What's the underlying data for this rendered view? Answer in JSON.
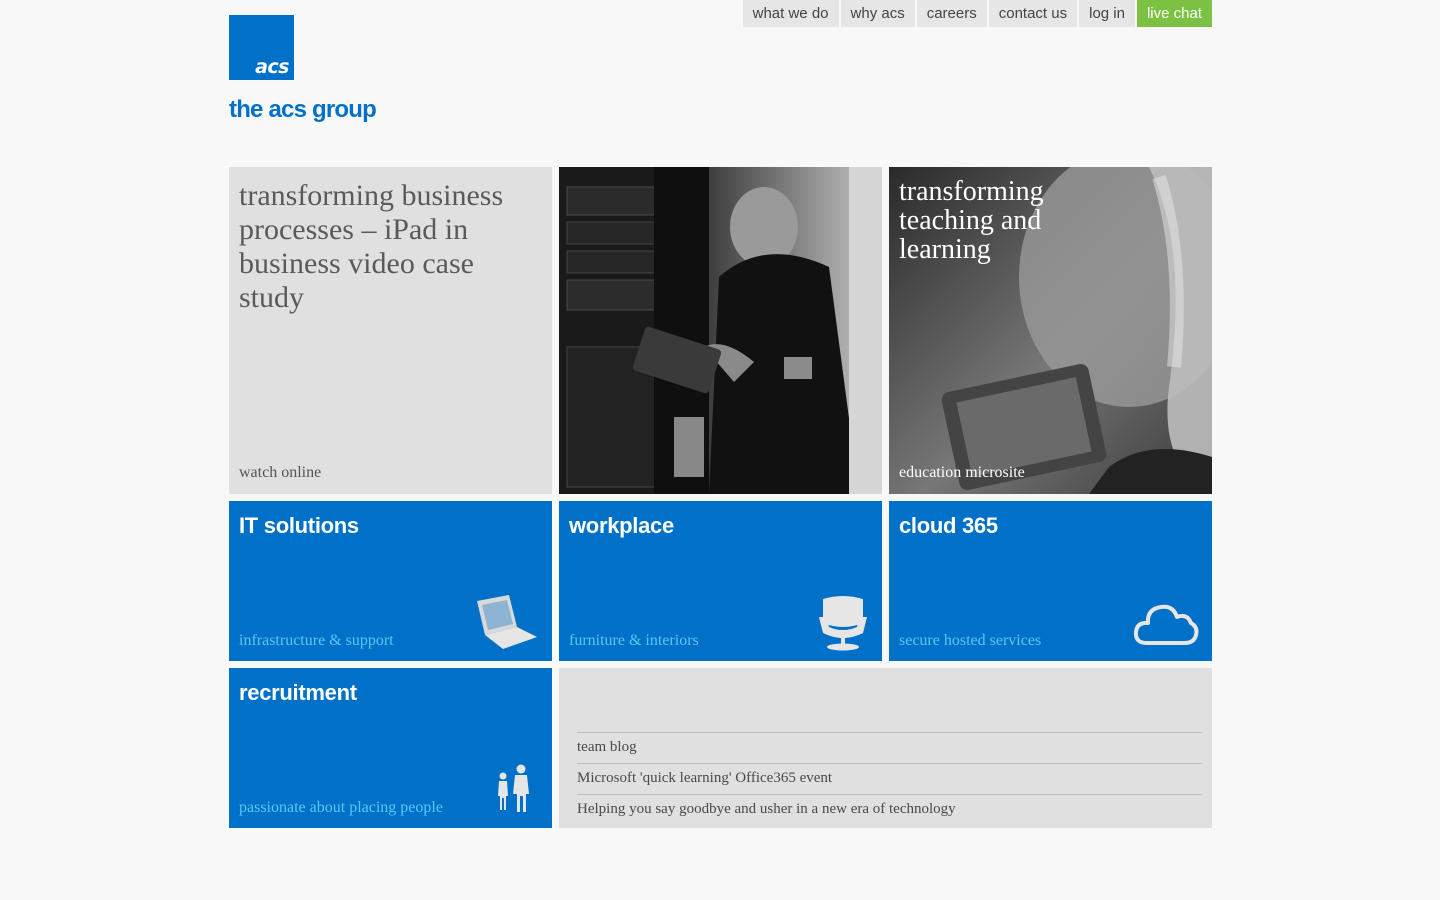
{
  "nav": {
    "items": [
      "what we do",
      "why acs",
      "careers",
      "contact us",
      "log in"
    ],
    "live_chat": "live chat"
  },
  "brand": {
    "logo_text": "acs",
    "site_title": "the acs group",
    "color": "#0070c8"
  },
  "featured": {
    "headline": "transforming business processes – iPad in business video case study",
    "sub": "watch online"
  },
  "education": {
    "headline": "transforming teaching and learning",
    "sub": "education microsite"
  },
  "tiles": {
    "it": {
      "title": "IT solutions",
      "sub": "infrastructure & support",
      "icon": "laptop-icon"
    },
    "workplace": {
      "title": "workplace",
      "sub": "furniture & interiors",
      "icon": "chair-icon"
    },
    "cloud": {
      "title": "cloud 365",
      "sub": "secure hosted services",
      "icon": "cloud-icon"
    },
    "recruitment": {
      "title": "recruitment",
      "sub": "passionate about placing people",
      "icon": "people-icon"
    }
  },
  "news": {
    "items": [
      "team blog",
      "Microsoft 'quick learning' Office365 event",
      "Helping you say goodbye and usher in a new era of technology"
    ]
  },
  "colors": {
    "blue": "#0070c8",
    "light_blue_text": "#5cc8f5",
    "live_chat": "#7cc142",
    "grey_tile": "#e0e0e0"
  }
}
